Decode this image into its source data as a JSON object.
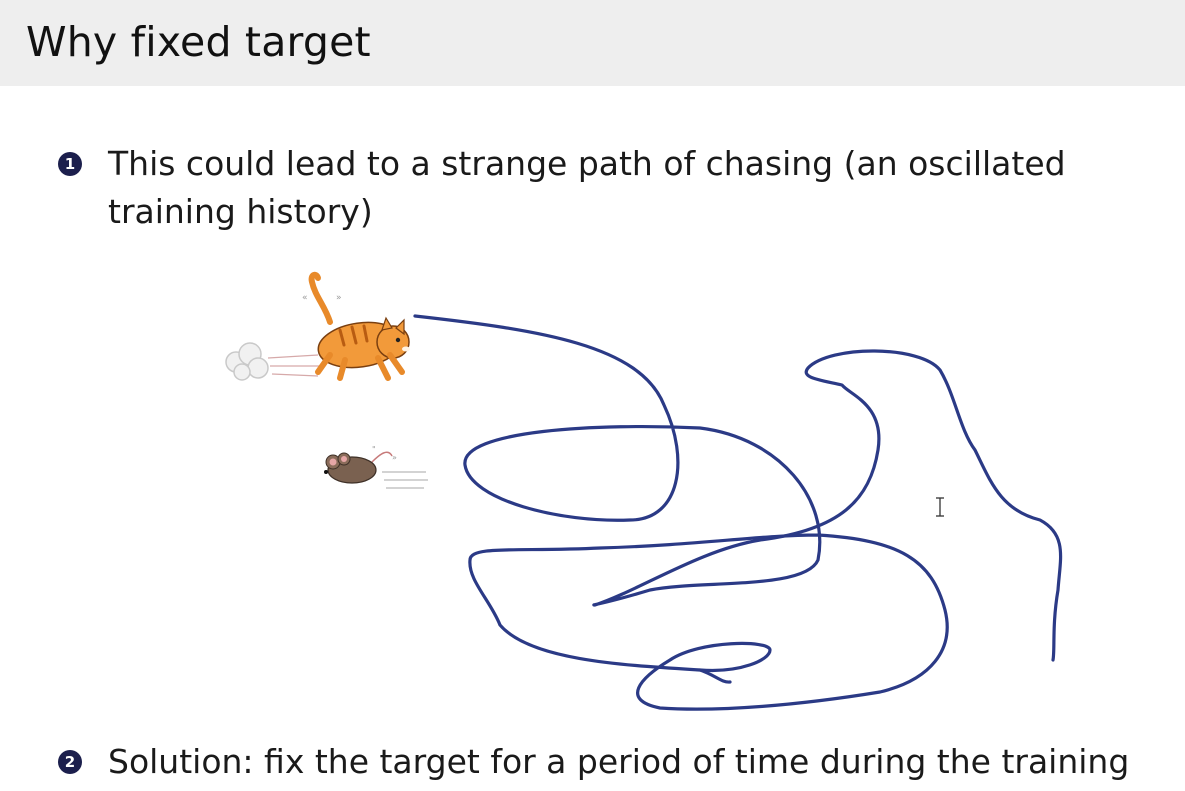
{
  "slide": {
    "title": "Why fixed target",
    "bullets": [
      {
        "number": "1",
        "text": "This could lead to a strange path of chasing (an oscillated training history)"
      },
      {
        "number": "2",
        "text": "Solution: fix the target for a period of time during the training"
      }
    ]
  },
  "illustration": {
    "cat_icon": "running-cat-icon",
    "mouse_icon": "running-mouse-icon",
    "path_color": "#2b3a86"
  },
  "colors": {
    "title_bar": "#eeeeee",
    "bullet_badge": "#1c1f4d"
  }
}
